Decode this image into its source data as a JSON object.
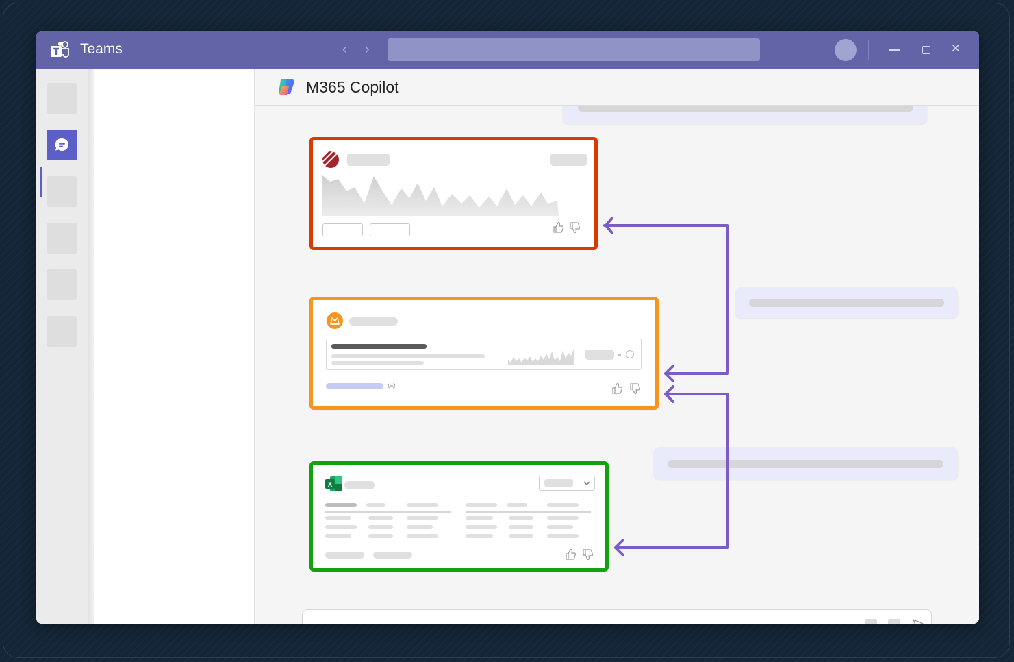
{
  "titlebar": {
    "app_name": "Teams",
    "back_glyph": "‹",
    "forward_glyph": "›",
    "close_glyph": "×",
    "bg_color": "#6264a7"
  },
  "rail": {
    "items": [
      "rail-item",
      "chat-icon",
      "rail-item",
      "rail-item",
      "rail-item",
      "rail-item"
    ],
    "active_index": 1
  },
  "chat": {
    "title": "M365 Copilot"
  },
  "cards": {
    "red": {
      "border_color": "#d83b01",
      "icon": "striped-ball-icon"
    },
    "orange": {
      "border_color": "#f7941d",
      "icon": "orange-app-icon"
    },
    "green": {
      "border_color": "#13a10e",
      "icon": "excel-icon",
      "excel_letter": "X"
    }
  },
  "arrows": {
    "color": "#7b5cc7"
  },
  "composer": {
    "icons": [
      "attach-icon",
      "format-icon",
      "send-icon"
    ]
  }
}
